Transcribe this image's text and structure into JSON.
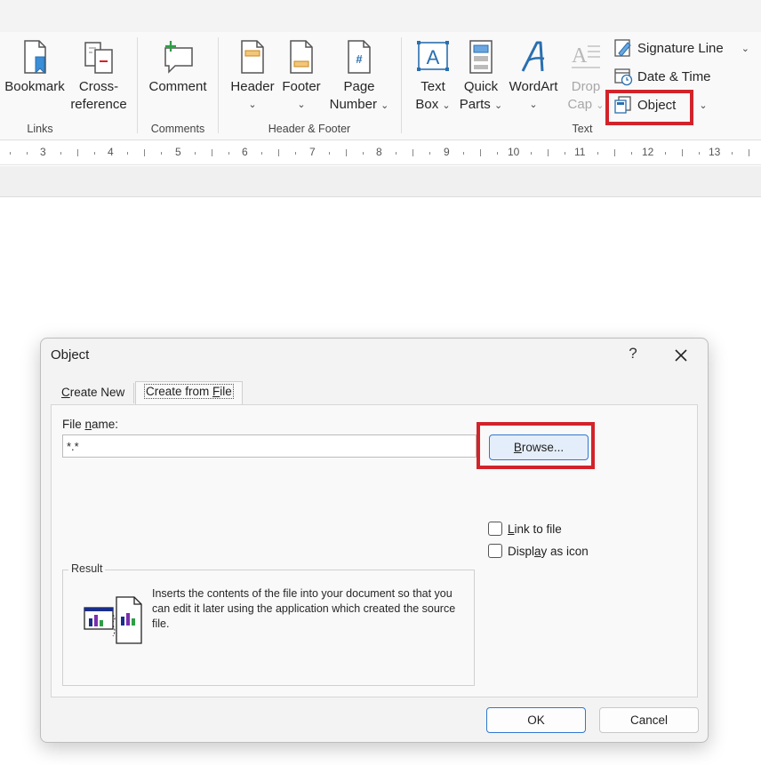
{
  "ribbon": {
    "links": {
      "bookmark": "Bookmark",
      "cross_ref_1": "Cross-",
      "cross_ref_2": "reference",
      "group": "Links"
    },
    "comments": {
      "comment": "Comment",
      "group": "Comments"
    },
    "header_footer": {
      "header": "Header",
      "footer": "Footer",
      "page_1": "Page",
      "page_2": "Number",
      "group": "Header & Footer"
    },
    "text": {
      "textbox_1": "Text",
      "textbox_2": "Box",
      "quickparts_1": "Quick",
      "quickparts_2": "Parts",
      "wordart": "WordArt",
      "dropcap_1": "Drop",
      "dropcap_2": "Cap",
      "signature_line": "Signature Line",
      "date_time": "Date & Time",
      "object": "Object",
      "group": "Text"
    }
  },
  "ruler": {
    "numbers": [
      "3",
      "4",
      "5",
      "6",
      "7",
      "8",
      "9",
      "10",
      "11",
      "12",
      "13"
    ]
  },
  "dialog": {
    "title": "Object",
    "help": "?",
    "tabs": {
      "create_new_pre": "",
      "create_new_key": "C",
      "create_new_post": "reate New",
      "from_file_pre": "Create from ",
      "from_file_key": "F",
      "from_file_post": "ile"
    },
    "file_name_pre": "File ",
    "file_name_key": "n",
    "file_name_post": "ame:",
    "file_name_value": "*.*",
    "browse_key": "B",
    "browse_post": "rowse...",
    "link_pre": "",
    "link_key": "L",
    "link_post": "ink to file",
    "display_pre": "Displ",
    "display_key": "a",
    "display_post": "y as icon",
    "result_label": "Result",
    "result_text": "Inserts the contents of the file into your document so that you can edit it later using the application which created the source file.",
    "ok": "OK",
    "cancel": "Cancel"
  },
  "colors": {
    "highlight": "#d2232a",
    "accent_blue": "#2f78d1",
    "ribbon_bg": "#f9f9f9",
    "dialog_bg": "#f3f3f3"
  },
  "icons": [
    "bookmark-icon",
    "cross-reference-icon",
    "comment-icon",
    "header-icon",
    "footer-icon",
    "page-number-icon",
    "text-box-icon",
    "quick-parts-icon",
    "wordart-icon",
    "drop-cap-icon",
    "signature-line-icon",
    "date-time-icon",
    "object-icon",
    "close-icon",
    "result-icon"
  ]
}
